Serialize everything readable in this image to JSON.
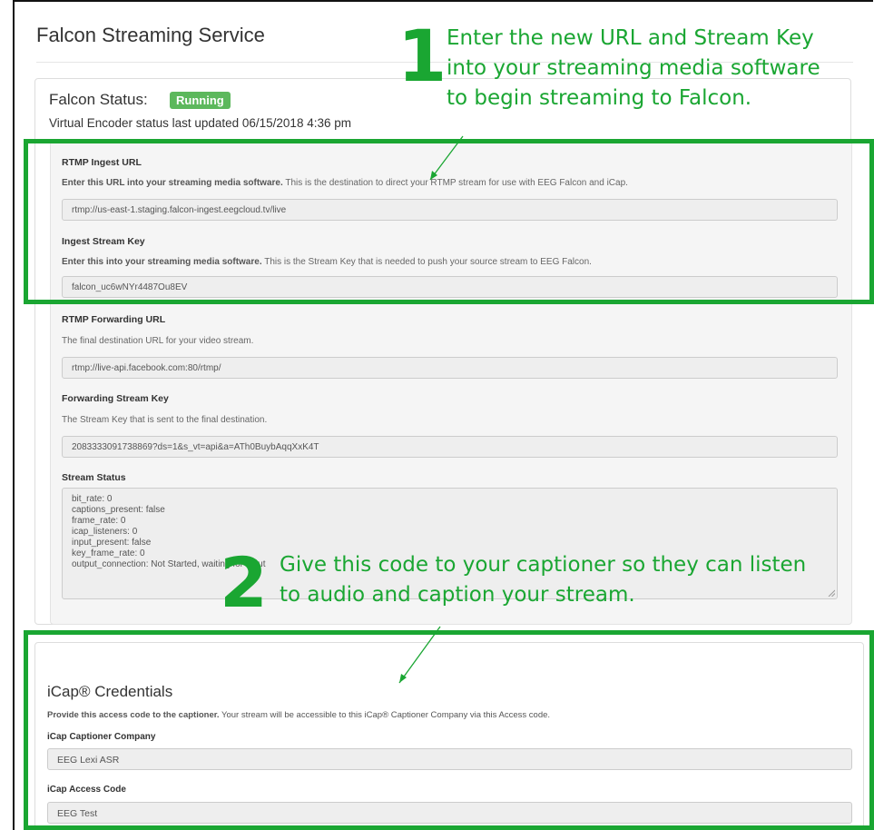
{
  "page": {
    "title": "Falcon Streaming Service"
  },
  "status": {
    "heading": "Falcon Status:",
    "badge": "Running",
    "updated": "Virtual Encoder status last updated 06/15/2018 4:36 pm"
  },
  "ingest_url": {
    "label": "RTMP Ingest URL",
    "help_bold": "Enter this URL into your streaming media software.",
    "help": " This is the destination to direct your RTMP stream for use with EEG Falcon and iCap.",
    "value": "rtmp://us-east-1.staging.falcon-ingest.eegcloud.tv/live"
  },
  "ingest_key": {
    "label": "Ingest Stream Key",
    "help_bold": "Enter this into your streaming media software.",
    "help": " This is the Stream Key that is needed to push your source stream to EEG Falcon.",
    "value": "falcon_uc6wNYr4487Ou8EV"
  },
  "forward_url": {
    "label": "RTMP Forwarding URL",
    "help": "The final destination URL for your video stream.",
    "value": "rtmp://live-api.facebook.com:80/rtmp/"
  },
  "forward_key": {
    "label": "Forwarding Stream Key",
    "help": "The Stream Key that is sent to the final destination.",
    "value": "2083333091738869?ds=1&s_vt=api&a=ATh0BuybAqqXxK4T"
  },
  "stream_status": {
    "label": "Stream Status",
    "lines": [
      "bit_rate: 0",
      "captions_present: false",
      "frame_rate: 0",
      "icap_listeners: 0",
      "input_present: false",
      "key_frame_rate: 0",
      "output_connection: Not Started, waiting for input"
    ]
  },
  "icap": {
    "heading": "iCap® Credentials",
    "help_bold": "Provide this access code to the captioner.",
    "help": " Your stream will be accessible to this iCap® Captioner Company via this Access code.",
    "company_label": "iCap Captioner Company",
    "company_value": "EEG Lexi ASR",
    "code_label": "iCap Access Code",
    "code_value": "EEG Test"
  },
  "annotations": {
    "step1_number": "1",
    "step1_lines": [
      "Enter the new URL and Stream Key",
      "into your streaming media software",
      "to begin streaming to Falcon."
    ],
    "step2_number": "2",
    "step2_lines": [
      "Give this code to your captioner so they can listen",
      "to audio and caption your stream."
    ]
  },
  "colors": {
    "annotation_green": "#1aa632",
    "badge_green": "#5cb85c"
  }
}
